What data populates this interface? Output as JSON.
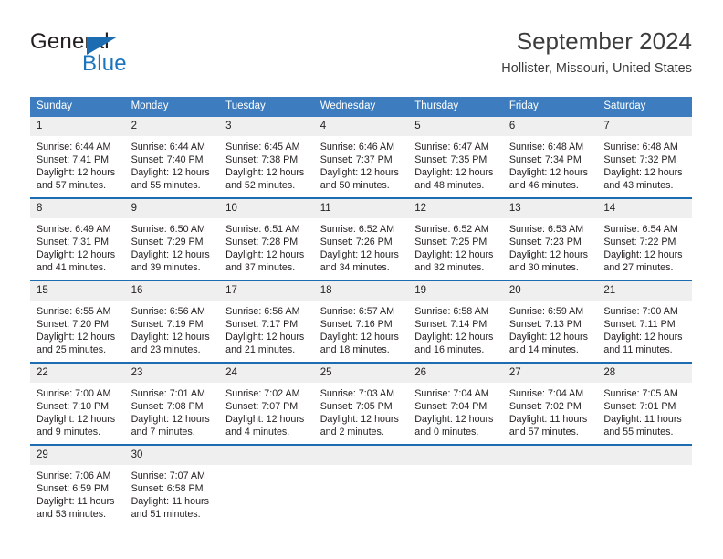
{
  "brand": {
    "name_part1": "General",
    "name_part2": "Blue",
    "accent_color": "#1b75bc"
  },
  "header": {
    "title": "September 2024",
    "subtitle": "Hollister, Missouri, United States"
  },
  "calendar": {
    "header_bg": "#3d7dbf",
    "daynum_bg": "#efefef",
    "separator_color": "#1b6cb0",
    "weekday_headers": [
      "Sunday",
      "Monday",
      "Tuesday",
      "Wednesday",
      "Thursday",
      "Friday",
      "Saturday"
    ],
    "weeks": [
      [
        {
          "day": "1",
          "sunrise": "Sunrise: 6:44 AM",
          "sunset": "Sunset: 7:41 PM",
          "daylight_line1": "Daylight: 12 hours",
          "daylight_line2": "and 57 minutes."
        },
        {
          "day": "2",
          "sunrise": "Sunrise: 6:44 AM",
          "sunset": "Sunset: 7:40 PM",
          "daylight_line1": "Daylight: 12 hours",
          "daylight_line2": "and 55 minutes."
        },
        {
          "day": "3",
          "sunrise": "Sunrise: 6:45 AM",
          "sunset": "Sunset: 7:38 PM",
          "daylight_line1": "Daylight: 12 hours",
          "daylight_line2": "and 52 minutes."
        },
        {
          "day": "4",
          "sunrise": "Sunrise: 6:46 AM",
          "sunset": "Sunset: 7:37 PM",
          "daylight_line1": "Daylight: 12 hours",
          "daylight_line2": "and 50 minutes."
        },
        {
          "day": "5",
          "sunrise": "Sunrise: 6:47 AM",
          "sunset": "Sunset: 7:35 PM",
          "daylight_line1": "Daylight: 12 hours",
          "daylight_line2": "and 48 minutes."
        },
        {
          "day": "6",
          "sunrise": "Sunrise: 6:48 AM",
          "sunset": "Sunset: 7:34 PM",
          "daylight_line1": "Daylight: 12 hours",
          "daylight_line2": "and 46 minutes."
        },
        {
          "day": "7",
          "sunrise": "Sunrise: 6:48 AM",
          "sunset": "Sunset: 7:32 PM",
          "daylight_line1": "Daylight: 12 hours",
          "daylight_line2": "and 43 minutes."
        }
      ],
      [
        {
          "day": "8",
          "sunrise": "Sunrise: 6:49 AM",
          "sunset": "Sunset: 7:31 PM",
          "daylight_line1": "Daylight: 12 hours",
          "daylight_line2": "and 41 minutes."
        },
        {
          "day": "9",
          "sunrise": "Sunrise: 6:50 AM",
          "sunset": "Sunset: 7:29 PM",
          "daylight_line1": "Daylight: 12 hours",
          "daylight_line2": "and 39 minutes."
        },
        {
          "day": "10",
          "sunrise": "Sunrise: 6:51 AM",
          "sunset": "Sunset: 7:28 PM",
          "daylight_line1": "Daylight: 12 hours",
          "daylight_line2": "and 37 minutes."
        },
        {
          "day": "11",
          "sunrise": "Sunrise: 6:52 AM",
          "sunset": "Sunset: 7:26 PM",
          "daylight_line1": "Daylight: 12 hours",
          "daylight_line2": "and 34 minutes."
        },
        {
          "day": "12",
          "sunrise": "Sunrise: 6:52 AM",
          "sunset": "Sunset: 7:25 PM",
          "daylight_line1": "Daylight: 12 hours",
          "daylight_line2": "and 32 minutes."
        },
        {
          "day": "13",
          "sunrise": "Sunrise: 6:53 AM",
          "sunset": "Sunset: 7:23 PM",
          "daylight_line1": "Daylight: 12 hours",
          "daylight_line2": "and 30 minutes."
        },
        {
          "day": "14",
          "sunrise": "Sunrise: 6:54 AM",
          "sunset": "Sunset: 7:22 PM",
          "daylight_line1": "Daylight: 12 hours",
          "daylight_line2": "and 27 minutes."
        }
      ],
      [
        {
          "day": "15",
          "sunrise": "Sunrise: 6:55 AM",
          "sunset": "Sunset: 7:20 PM",
          "daylight_line1": "Daylight: 12 hours",
          "daylight_line2": "and 25 minutes."
        },
        {
          "day": "16",
          "sunrise": "Sunrise: 6:56 AM",
          "sunset": "Sunset: 7:19 PM",
          "daylight_line1": "Daylight: 12 hours",
          "daylight_line2": "and 23 minutes."
        },
        {
          "day": "17",
          "sunrise": "Sunrise: 6:56 AM",
          "sunset": "Sunset: 7:17 PM",
          "daylight_line1": "Daylight: 12 hours",
          "daylight_line2": "and 21 minutes."
        },
        {
          "day": "18",
          "sunrise": "Sunrise: 6:57 AM",
          "sunset": "Sunset: 7:16 PM",
          "daylight_line1": "Daylight: 12 hours",
          "daylight_line2": "and 18 minutes."
        },
        {
          "day": "19",
          "sunrise": "Sunrise: 6:58 AM",
          "sunset": "Sunset: 7:14 PM",
          "daylight_line1": "Daylight: 12 hours",
          "daylight_line2": "and 16 minutes."
        },
        {
          "day": "20",
          "sunrise": "Sunrise: 6:59 AM",
          "sunset": "Sunset: 7:13 PM",
          "daylight_line1": "Daylight: 12 hours",
          "daylight_line2": "and 14 minutes."
        },
        {
          "day": "21",
          "sunrise": "Sunrise: 7:00 AM",
          "sunset": "Sunset: 7:11 PM",
          "daylight_line1": "Daylight: 12 hours",
          "daylight_line2": "and 11 minutes."
        }
      ],
      [
        {
          "day": "22",
          "sunrise": "Sunrise: 7:00 AM",
          "sunset": "Sunset: 7:10 PM",
          "daylight_line1": "Daylight: 12 hours",
          "daylight_line2": "and 9 minutes."
        },
        {
          "day": "23",
          "sunrise": "Sunrise: 7:01 AM",
          "sunset": "Sunset: 7:08 PM",
          "daylight_line1": "Daylight: 12 hours",
          "daylight_line2": "and 7 minutes."
        },
        {
          "day": "24",
          "sunrise": "Sunrise: 7:02 AM",
          "sunset": "Sunset: 7:07 PM",
          "daylight_line1": "Daylight: 12 hours",
          "daylight_line2": "and 4 minutes."
        },
        {
          "day": "25",
          "sunrise": "Sunrise: 7:03 AM",
          "sunset": "Sunset: 7:05 PM",
          "daylight_line1": "Daylight: 12 hours",
          "daylight_line2": "and 2 minutes."
        },
        {
          "day": "26",
          "sunrise": "Sunrise: 7:04 AM",
          "sunset": "Sunset: 7:04 PM",
          "daylight_line1": "Daylight: 12 hours",
          "daylight_line2": "and 0 minutes."
        },
        {
          "day": "27",
          "sunrise": "Sunrise: 7:04 AM",
          "sunset": "Sunset: 7:02 PM",
          "daylight_line1": "Daylight: 11 hours",
          "daylight_line2": "and 57 minutes."
        },
        {
          "day": "28",
          "sunrise": "Sunrise: 7:05 AM",
          "sunset": "Sunset: 7:01 PM",
          "daylight_line1": "Daylight: 11 hours",
          "daylight_line2": "and 55 minutes."
        }
      ],
      [
        {
          "day": "29",
          "sunrise": "Sunrise: 7:06 AM",
          "sunset": "Sunset: 6:59 PM",
          "daylight_line1": "Daylight: 11 hours",
          "daylight_line2": "and 53 minutes."
        },
        {
          "day": "30",
          "sunrise": "Sunrise: 7:07 AM",
          "sunset": "Sunset: 6:58 PM",
          "daylight_line1": "Daylight: 11 hours",
          "daylight_line2": "and 51 minutes."
        },
        {
          "day": "",
          "sunrise": "",
          "sunset": "",
          "daylight_line1": "",
          "daylight_line2": ""
        },
        {
          "day": "",
          "sunrise": "",
          "sunset": "",
          "daylight_line1": "",
          "daylight_line2": ""
        },
        {
          "day": "",
          "sunrise": "",
          "sunset": "",
          "daylight_line1": "",
          "daylight_line2": ""
        },
        {
          "day": "",
          "sunrise": "",
          "sunset": "",
          "daylight_line1": "",
          "daylight_line2": ""
        },
        {
          "day": "",
          "sunrise": "",
          "sunset": "",
          "daylight_line1": "",
          "daylight_line2": ""
        }
      ]
    ]
  }
}
